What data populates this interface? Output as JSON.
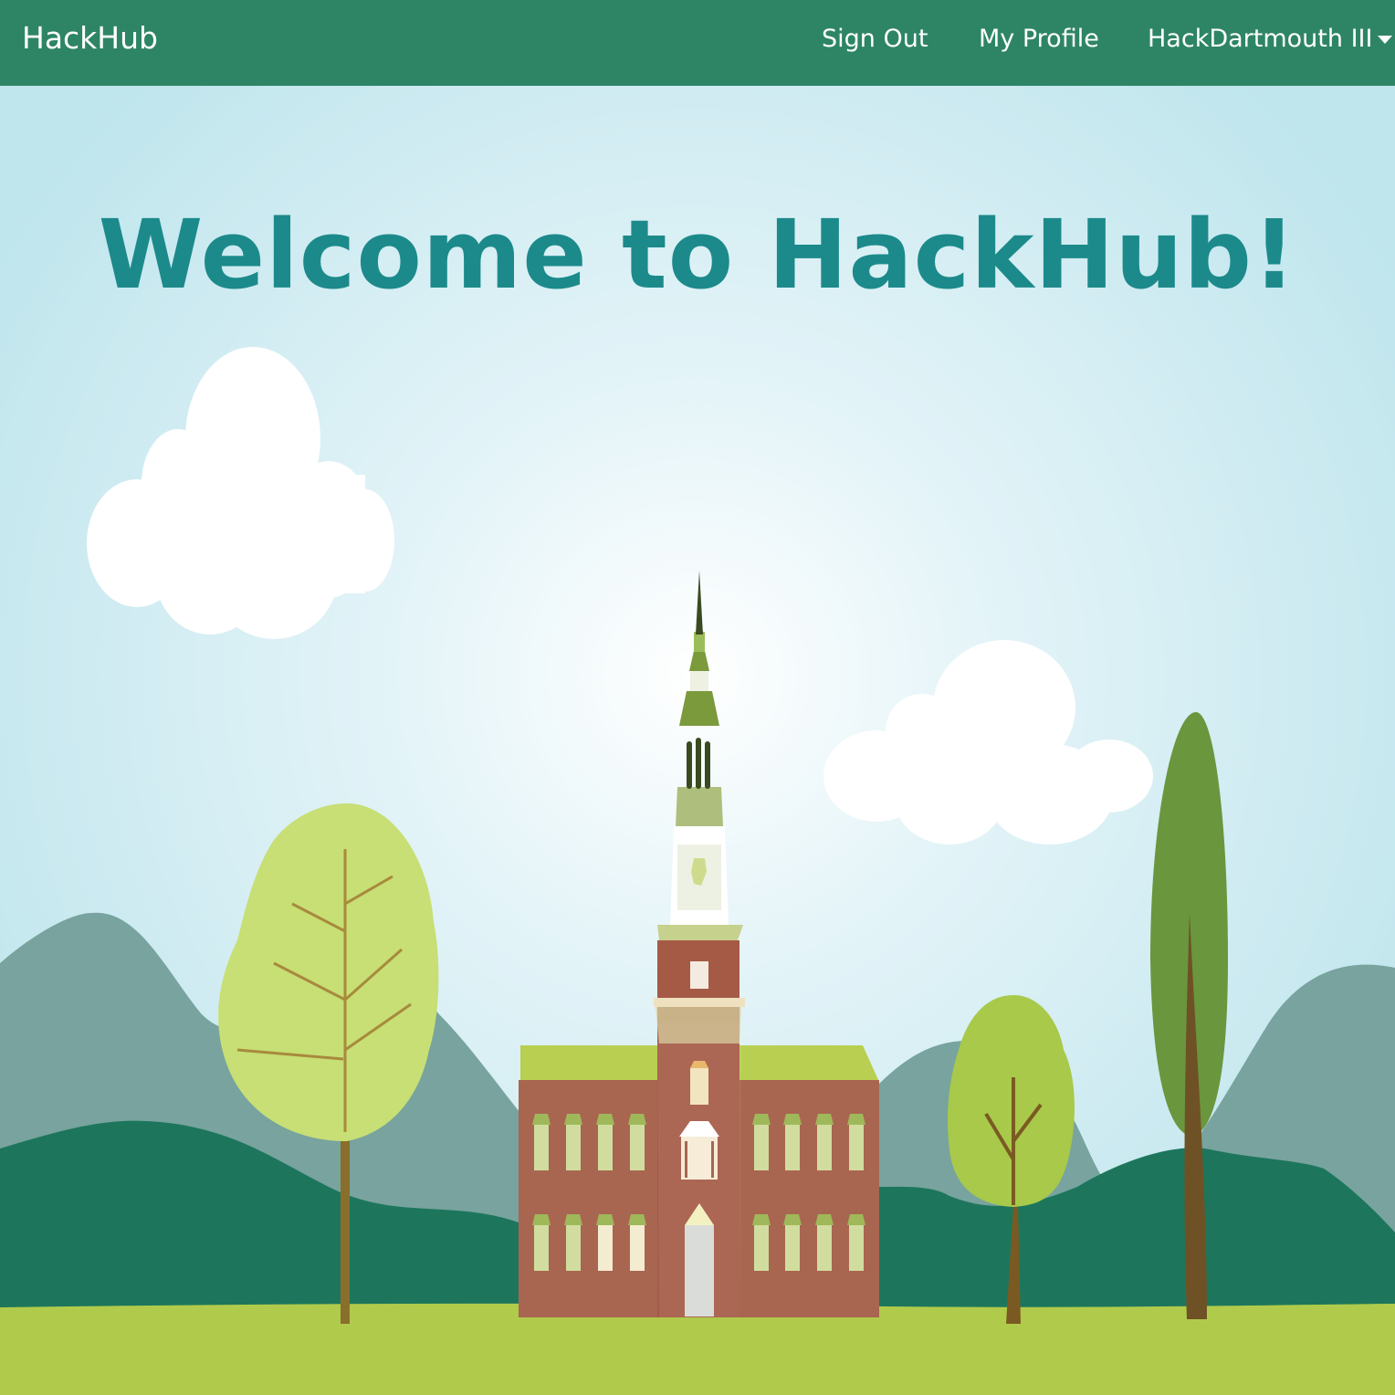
{
  "navbar": {
    "brand": "HackHub",
    "links": {
      "sign_out": "Sign Out",
      "my_profile": "My Profile",
      "event": "HackDartmouth III"
    },
    "event_dropdown_icon": "caret-down-icon"
  },
  "hero": {
    "title": "Welcome to HackHub!",
    "illustration": "dartmouth-hall-landscape"
  },
  "colors": {
    "navbar": "#2e8566",
    "title": "#1c8a8b",
    "sky": "#c2e6ee",
    "grass": "#b0cb4b"
  }
}
